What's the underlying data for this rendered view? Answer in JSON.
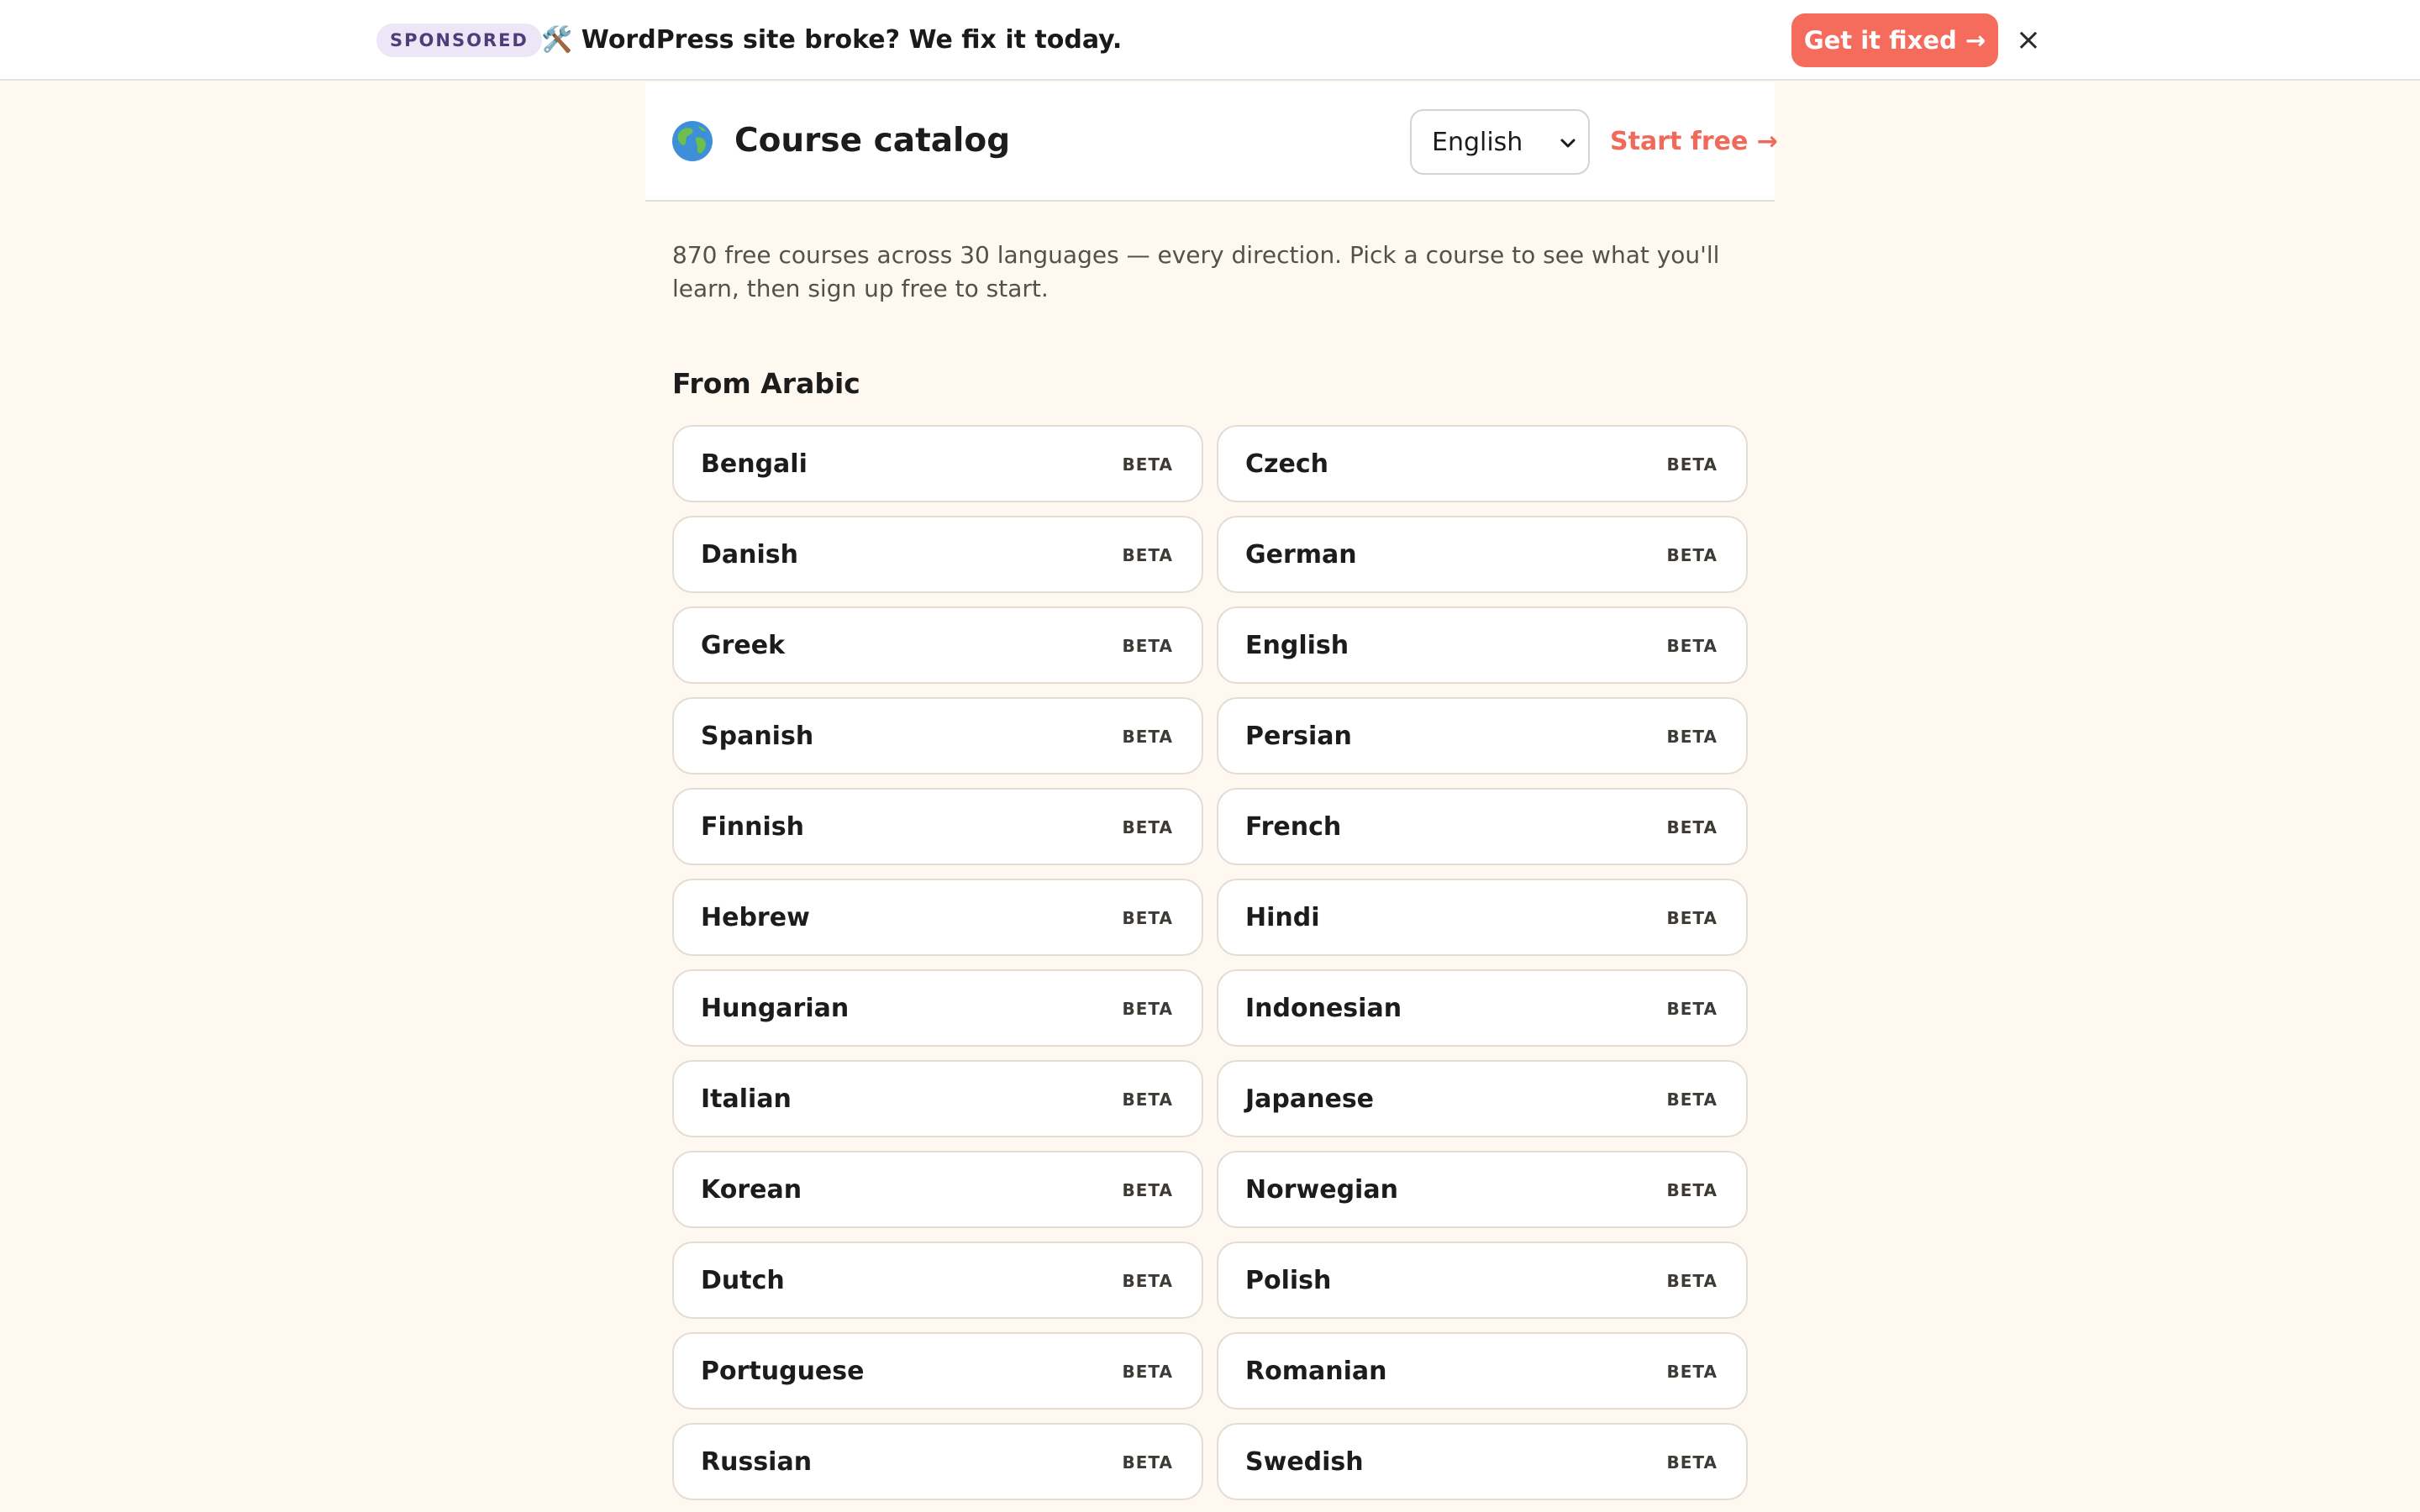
{
  "ad": {
    "badge": "SPONSORED",
    "text": "🛠️ WordPress site broke? We fix it today.",
    "cta": "Get it fixed →",
    "close": "×"
  },
  "header": {
    "title": "Course catalog",
    "language_select": {
      "value": "English"
    },
    "start_link": "Start free →",
    "icon": "globe-icon"
  },
  "intro": "870 free courses across 30 languages — every direction. Pick a course to see what you'll learn, then sign up free to start.",
  "section": {
    "title": "From Arabic",
    "courses": [
      {
        "label": "Bengali",
        "badge": "BETA"
      },
      {
        "label": "Czech",
        "badge": "BETA"
      },
      {
        "label": "Danish",
        "badge": "BETA"
      },
      {
        "label": "German",
        "badge": "BETA"
      },
      {
        "label": "Greek",
        "badge": "BETA"
      },
      {
        "label": "English",
        "badge": "BETA"
      },
      {
        "label": "Spanish",
        "badge": "BETA"
      },
      {
        "label": "Persian",
        "badge": "BETA"
      },
      {
        "label": "Finnish",
        "badge": "BETA"
      },
      {
        "label": "French",
        "badge": "BETA"
      },
      {
        "label": "Hebrew",
        "badge": "BETA"
      },
      {
        "label": "Hindi",
        "badge": "BETA"
      },
      {
        "label": "Hungarian",
        "badge": "BETA"
      },
      {
        "label": "Indonesian",
        "badge": "BETA"
      },
      {
        "label": "Italian",
        "badge": "BETA"
      },
      {
        "label": "Japanese",
        "badge": "BETA"
      },
      {
        "label": "Korean",
        "badge": "BETA"
      },
      {
        "label": "Norwegian",
        "badge": "BETA"
      },
      {
        "label": "Dutch",
        "badge": "BETA"
      },
      {
        "label": "Polish",
        "badge": "BETA"
      },
      {
        "label": "Portuguese",
        "badge": "BETA"
      },
      {
        "label": "Romanian",
        "badge": "BETA"
      },
      {
        "label": "Russian",
        "badge": "BETA"
      },
      {
        "label": "Swedish",
        "badge": "BETA"
      }
    ]
  },
  "colors": {
    "page_bg": "#fef8f1",
    "accent": "#f56b5c",
    "badge_bg": "#ece6f6"
  }
}
